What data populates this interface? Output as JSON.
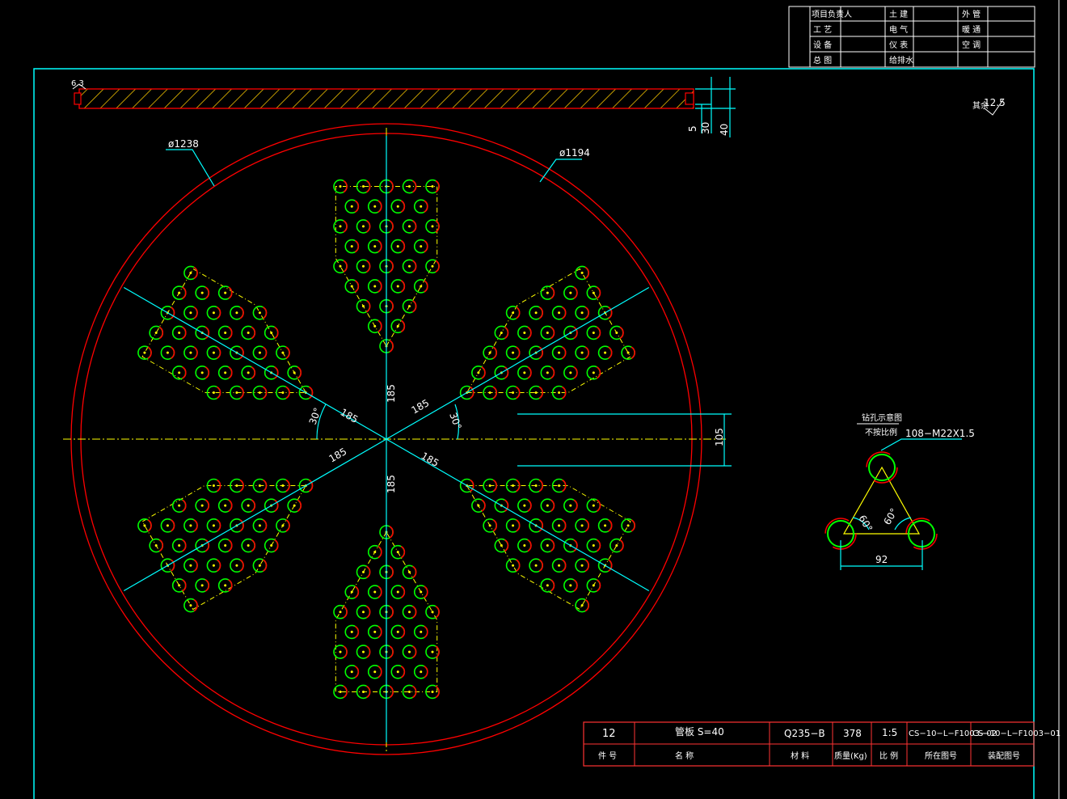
{
  "title_block": {
    "rows": [
      [
        "项目负责人",
        "土 建",
        "外 管"
      ],
      [
        "工 艺",
        "电 气",
        "暖 通"
      ],
      [
        "设 备",
        "仪 表",
        "空 调"
      ],
      [
        "总 图",
        "给排水",
        ""
      ]
    ]
  },
  "section": {
    "surface_label": "6.3",
    "dims": [
      "5",
      "30",
      "40"
    ]
  },
  "roughness_note": {
    "prefix": "其余",
    "value": "12.5"
  },
  "main_view": {
    "outer_dia": "ø1238",
    "inner_dia": "ø1194",
    "radial_dims": [
      "185",
      "185",
      "185",
      "185",
      "185",
      "185"
    ],
    "angle_dims": [
      "30°",
      "30°"
    ],
    "offset_dim": "105"
  },
  "detail": {
    "title": "钻孔示意图",
    "scale_note": "不按比例",
    "hole_spec": "108−M22X1.5",
    "angles": [
      "60°",
      "60°"
    ],
    "spacing": "92"
  },
  "parts_table": {
    "values": [
      "12",
      "管板 S=40",
      "Q235−B",
      "378",
      "1:5",
      "CS−10−L−F1003−02",
      "CS−10−L−F1003−01"
    ],
    "headers": [
      "件 号",
      "名    称",
      "材 料",
      "质量(Kg)",
      "比 例",
      "所在图号",
      "装配图号"
    ]
  },
  "colors": {
    "frame": "#00ffff",
    "circle": "#ff0000",
    "center_line": "#ffff00",
    "hole": "#00ff00",
    "text": "#ffffff"
  }
}
